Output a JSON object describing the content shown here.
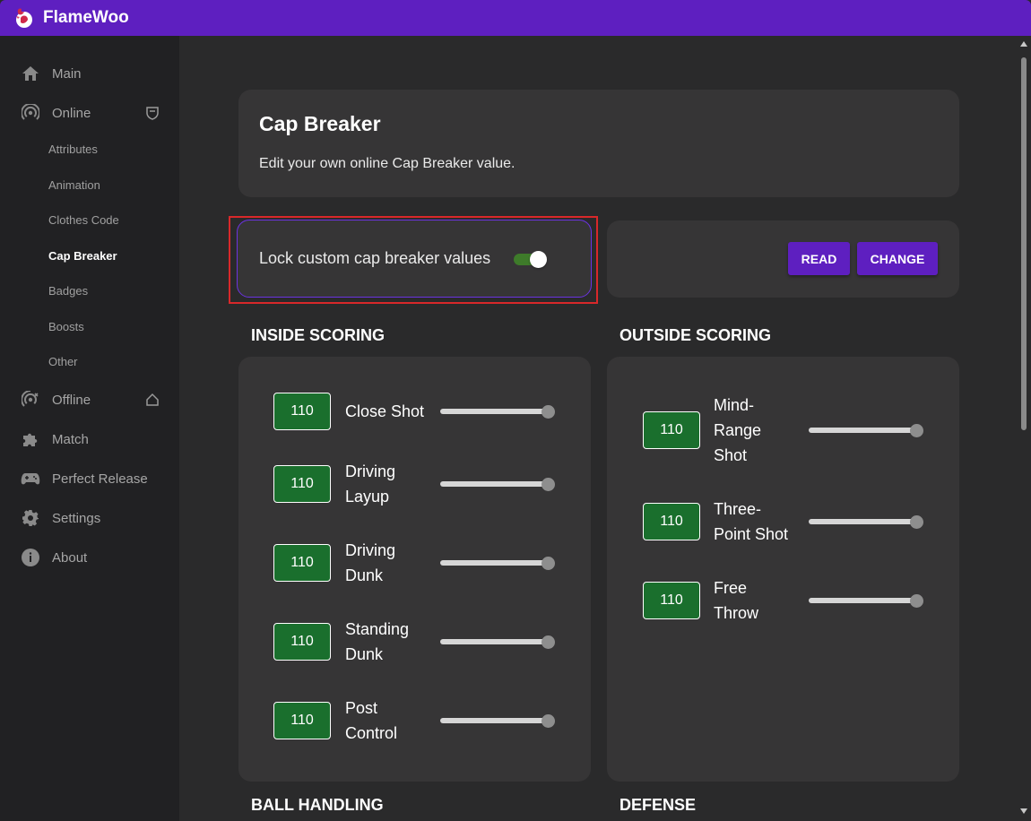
{
  "app": {
    "title": "FlameWoo"
  },
  "sidebar": {
    "items": [
      {
        "label": "Main",
        "icon": "home-icon"
      },
      {
        "label": "Online",
        "icon": "online-icon"
      },
      {
        "label": "Offline",
        "icon": "offline-icon"
      },
      {
        "label": "Match",
        "icon": "puzzle-icon"
      },
      {
        "label": "Perfect Release",
        "icon": "gamepad-icon"
      },
      {
        "label": "Settings",
        "icon": "gear-icon"
      },
      {
        "label": "About",
        "icon": "info-icon"
      }
    ],
    "online_subitems": [
      "Attributes",
      "Animation",
      "Clothes Code",
      "Cap Breaker",
      "Badges",
      "Boosts",
      "Other"
    ],
    "active_subitem": "Cap Breaker"
  },
  "page": {
    "title": "Cap Breaker",
    "description": "Edit your own online Cap Breaker value."
  },
  "lock": {
    "label": "Lock custom cap breaker values",
    "enabled": true
  },
  "actions": {
    "read_label": "READ",
    "change_label": "CHANGE"
  },
  "sections": {
    "inside": {
      "heading": "INSIDE SCORING",
      "attributes": [
        {
          "label_lines": [
            "Close Shot"
          ],
          "value": "110",
          "slider_fraction": 1.0
        },
        {
          "label_lines": [
            "Driving",
            "Layup"
          ],
          "value": "110",
          "slider_fraction": 1.0
        },
        {
          "label_lines": [
            "Driving",
            "Dunk"
          ],
          "value": "110",
          "slider_fraction": 1.0
        },
        {
          "label_lines": [
            "Standing",
            "Dunk"
          ],
          "value": "110",
          "slider_fraction": 1.0
        },
        {
          "label_lines": [
            "Post",
            "Control"
          ],
          "value": "110",
          "slider_fraction": 1.0
        }
      ]
    },
    "outside": {
      "heading": "OUTSIDE SCORING",
      "attributes": [
        {
          "label_lines": [
            "Mind-",
            "Range",
            "Shot"
          ],
          "value": "110",
          "slider_fraction": 1.0
        },
        {
          "label_lines": [
            "Three-",
            "Point Shot"
          ],
          "value": "110",
          "slider_fraction": 1.0
        },
        {
          "label_lines": [
            "Free",
            "Throw"
          ],
          "value": "110",
          "slider_fraction": 1.0
        }
      ]
    },
    "ball_handling": {
      "heading": "BALL HANDLING"
    },
    "defense": {
      "heading": "DEFENSE"
    }
  },
  "colors": {
    "titlebar": "#5e1fc0",
    "accent": "#5e1fc0",
    "value_box": "#1a6f2d",
    "toggle_on": "#3e7b2a",
    "highlight_outline": "#d8282a"
  }
}
